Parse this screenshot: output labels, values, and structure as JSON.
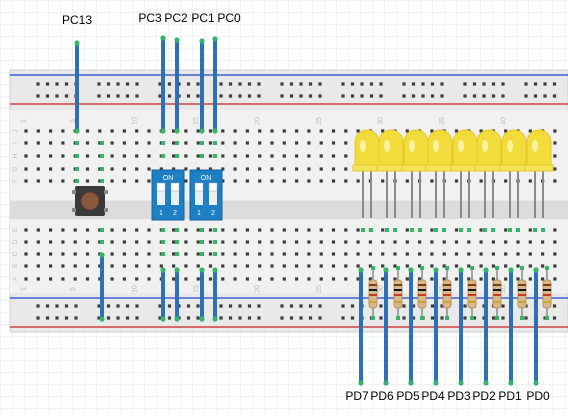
{
  "top_labels": {
    "pc13": "PC13",
    "pc3": "PC3",
    "pc2": "PC2",
    "pc1": "PC1",
    "pc0": "PC0"
  },
  "bottom_labels": [
    "PD7",
    "PD6",
    "PD5",
    "PD4",
    "PD3",
    "PD2",
    "PD1",
    "PD0"
  ],
  "breadboard": {
    "column_numbers": [
      "1",
      "5",
      "10",
      "15",
      "20",
      "25",
      "30",
      "35",
      "40"
    ],
    "row_letters_top": [
      "J",
      "I",
      "H",
      "G",
      "F"
    ],
    "row_letters_bottom": [
      "E",
      "D",
      "C",
      "B",
      "A"
    ]
  },
  "dip_switches": [
    {
      "on_label": "ON",
      "pin_labels": [
        "1",
        "2"
      ]
    },
    {
      "on_label": "ON",
      "pin_labels": [
        "1",
        "2"
      ]
    }
  ],
  "colors": {
    "wire": "#2f6fb5",
    "wire_end": "#35b46a",
    "led": "#f2dc3b",
    "dip_body": "#1f7fc4",
    "rail_blue": "#3b5fd0",
    "rail_red": "#d04040"
  },
  "icons": {
    "pushbutton": "tactile-switch-icon",
    "led": "led-icon",
    "resistor": "resistor-icon"
  }
}
